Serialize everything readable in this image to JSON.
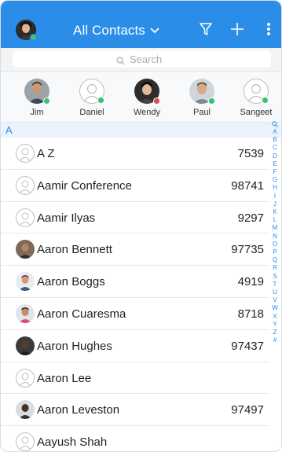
{
  "header": {
    "title": "All Contacts",
    "chevron_icon": "chevron-down-icon",
    "filter_icon": "filter-icon",
    "add_icon": "plus-icon",
    "more_icon": "vertical-ellipsis-icon",
    "accent_color": "#2a8ee8",
    "my_status": "online"
  },
  "search": {
    "placeholder": "Search",
    "icon": "search-icon"
  },
  "favorites": [
    {
      "name": "Jim",
      "status": "online",
      "status_color": "#38c172",
      "avatar": "photo"
    },
    {
      "name": "Daniel",
      "status": "online",
      "status_color": "#38c172",
      "avatar": "placeholder"
    },
    {
      "name": "Wendy",
      "status": "busy",
      "status_color": "#e5484d",
      "avatar": "photo"
    },
    {
      "name": "Paul",
      "status": "online",
      "status_color": "#38c172",
      "avatar": "photo"
    },
    {
      "name": "Sangeet",
      "status": "online",
      "status_color": "#38c172",
      "avatar": "placeholder"
    }
  ],
  "section_letter": "A",
  "contacts": [
    {
      "name": "A Z",
      "ext": "7539",
      "avatar": "placeholder"
    },
    {
      "name": "Aamir Conference",
      "ext": "98741",
      "avatar": "placeholder"
    },
    {
      "name": "Aamir Ilyas",
      "ext": "9297",
      "avatar": "placeholder"
    },
    {
      "name": "Aaron Bennett",
      "ext": "97735",
      "avatar": "photo"
    },
    {
      "name": "Aaron Boggs",
      "ext": "4919",
      "avatar": "photo"
    },
    {
      "name": "Aaron Cuaresma",
      "ext": "8718",
      "avatar": "photo"
    },
    {
      "name": "Aaron Hughes",
      "ext": "97437",
      "avatar": "photo"
    },
    {
      "name": "Aaron Lee",
      "ext": "",
      "avatar": "placeholder"
    },
    {
      "name": "Aaron Leveston",
      "ext": "97497",
      "avatar": "photo"
    },
    {
      "name": "Aayush Shah",
      "ext": "",
      "avatar": "placeholder"
    }
  ],
  "alphabet_index": [
    "A",
    "B",
    "C",
    "D",
    "E",
    "F",
    "G",
    "H",
    "I",
    "J",
    "K",
    "L",
    "M",
    "N",
    "O",
    "P",
    "Q",
    "R",
    "S",
    "T",
    "U",
    "V",
    "W",
    "X",
    "Y",
    "Z",
    "#"
  ]
}
